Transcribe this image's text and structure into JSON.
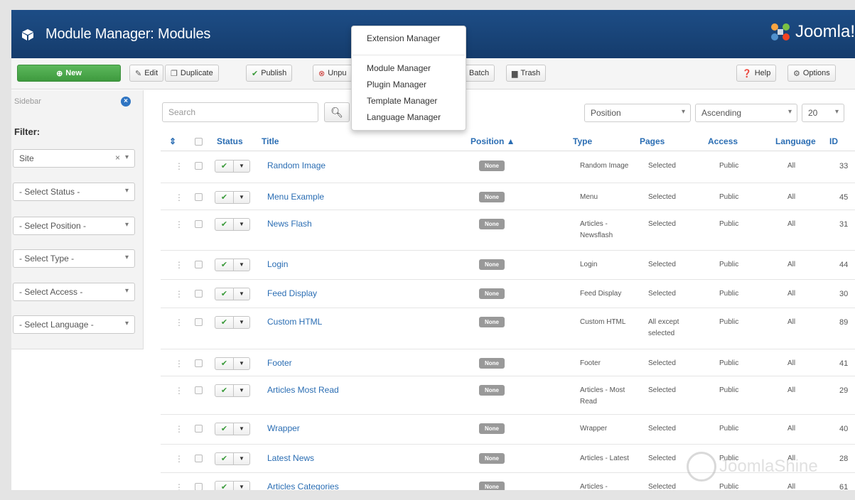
{
  "header": {
    "title": "Module Manager: Modules",
    "brand": "Joomla!",
    "brand_colors": [
      "#f9a541",
      "#7ac143",
      "#f44321",
      "#5091cd"
    ]
  },
  "extensions_menu": {
    "items": [
      "Extension Manager",
      "Module Manager",
      "Plugin Manager",
      "Template Manager",
      "Language Manager"
    ]
  },
  "toolbar": {
    "new": "New",
    "edit": "Edit",
    "duplicate": "Duplicate",
    "publish": "Publish",
    "unpublish_partial": "Unpu",
    "batch": "Batch",
    "trash": "Trash",
    "help": "Help",
    "options": "Options"
  },
  "sidebar": {
    "label": "Sidebar",
    "filter_label": "Filter:",
    "filters": [
      {
        "value": "Site",
        "clearable": true
      },
      {
        "value": "- Select Status -"
      },
      {
        "value": "- Select Position -"
      },
      {
        "value": "- Select Type -"
      },
      {
        "value": "- Select Access -"
      },
      {
        "value": "- Select Language -"
      }
    ]
  },
  "search": {
    "placeholder": "Search"
  },
  "ordering": {
    "field": "Position",
    "direction": "Ascending",
    "limit": "20"
  },
  "table": {
    "columns": {
      "sort": "⇕",
      "status": "Status",
      "title": "Title",
      "position": "Position ▲",
      "type": "Type",
      "pages": "Pages",
      "access": "Access",
      "language": "Language",
      "id": "ID"
    },
    "rows": [
      {
        "title": "Random Image",
        "position": "None",
        "type": "Random Image",
        "pages": "Selected",
        "access": "Public",
        "language": "All",
        "id": "33"
      },
      {
        "title": "Menu Example",
        "position": "None",
        "type": "Menu",
        "pages": "Selected",
        "access": "Public",
        "language": "All",
        "id": "45"
      },
      {
        "title": "News Flash",
        "position": "None",
        "type": "Articles - Newsflash",
        "pages": "Selected",
        "access": "Public",
        "language": "All",
        "id": "31"
      },
      {
        "title": "Login",
        "position": "None",
        "type": "Login",
        "pages": "Selected",
        "access": "Public",
        "language": "All",
        "id": "44"
      },
      {
        "title": "Feed Display",
        "position": "None",
        "type": "Feed Display",
        "pages": "Selected",
        "access": "Public",
        "language": "All",
        "id": "30"
      },
      {
        "title": "Custom HTML",
        "position": "None",
        "type": "Custom HTML",
        "pages": "All except selected",
        "access": "Public",
        "language": "All",
        "id": "89"
      },
      {
        "title": "Footer",
        "position": "None",
        "type": "Footer",
        "pages": "Selected",
        "access": "Public",
        "language": "All",
        "id": "41"
      },
      {
        "title": "Articles Most Read",
        "position": "None",
        "type": "Articles - Most Read",
        "pages": "Selected",
        "access": "Public",
        "language": "All",
        "id": "29"
      },
      {
        "title": "Wrapper",
        "position": "None",
        "type": "Wrapper",
        "pages": "Selected",
        "access": "Public",
        "language": "All",
        "id": "40"
      },
      {
        "title": "Latest News",
        "position": "None",
        "type": "Articles - Latest",
        "pages": "Selected",
        "access": "Public",
        "language": "All",
        "id": "28"
      },
      {
        "title": "Articles Categories",
        "position": "None",
        "type": "Articles - Categories",
        "pages": "Selected",
        "access": "Public",
        "language": "All",
        "id": "61"
      }
    ]
  },
  "watermark": "JoomlaShine"
}
